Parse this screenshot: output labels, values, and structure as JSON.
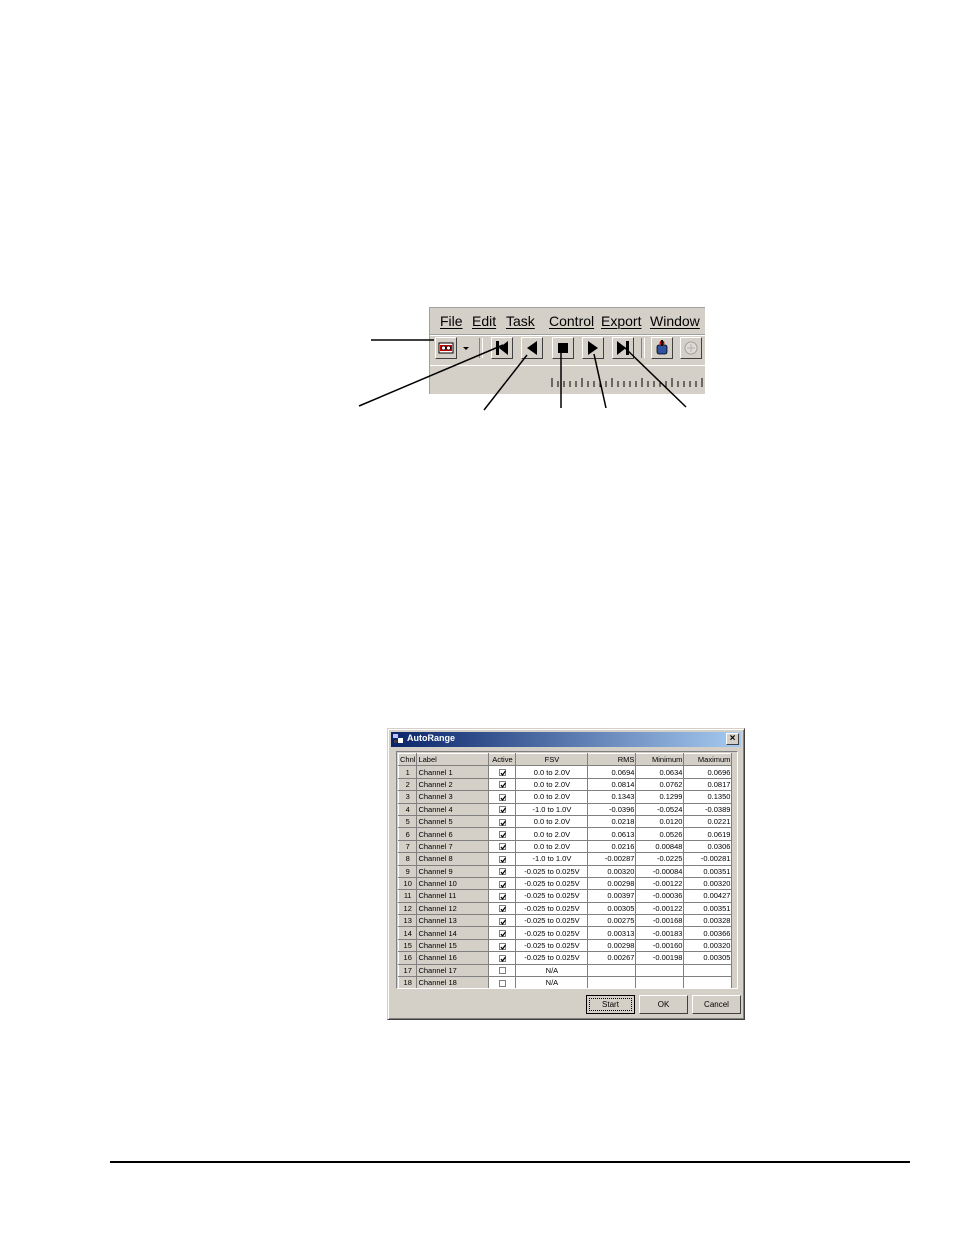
{
  "toolbar_screenshot": {
    "menu": [
      "File",
      "Edit",
      "Task",
      "Control",
      "Export",
      "Window"
    ],
    "buttons": [
      {
        "name": "record-icon"
      },
      {
        "name": "dropdown-arrow-icon"
      },
      {
        "name": "skip-to-start-icon"
      },
      {
        "name": "reverse-play-icon"
      },
      {
        "name": "stop-icon"
      },
      {
        "name": "play-icon"
      },
      {
        "name": "skip-to-end-icon"
      },
      {
        "name": "acquire-icon"
      },
      {
        "name": "disabled-tool-icon"
      }
    ]
  },
  "dialog": {
    "title": "AutoRange",
    "close": "×",
    "columns": [
      "Chnl",
      "Label",
      "Active",
      "FSV",
      "RMS",
      "Minimum",
      "Maximum"
    ],
    "rows": [
      {
        "chnl": "1",
        "label": "Channel 1",
        "active": true,
        "fsv": "0.0 to 2.0V",
        "rms": "0.0694",
        "min": "0.0634",
        "max": "0.0696"
      },
      {
        "chnl": "2",
        "label": "Channel 2",
        "active": true,
        "fsv": "0.0 to 2.0V",
        "rms": "0.0814",
        "min": "0.0762",
        "max": "0.0817"
      },
      {
        "chnl": "3",
        "label": "Channel 3",
        "active": true,
        "fsv": "0.0 to 2.0V",
        "rms": "0.1343",
        "min": "0.1299",
        "max": "0.1350"
      },
      {
        "chnl": "4",
        "label": "Channel 4",
        "active": true,
        "fsv": "-1.0 to 1.0V",
        "rms": "-0.0396",
        "min": "-0.0524",
        "max": "-0.0389"
      },
      {
        "chnl": "5",
        "label": "Channel 5",
        "active": true,
        "fsv": "0.0 to 2.0V",
        "rms": "0.0218",
        "min": "0.0120",
        "max": "0.0221"
      },
      {
        "chnl": "6",
        "label": "Channel 6",
        "active": true,
        "fsv": "0.0 to 2.0V",
        "rms": "0.0613",
        "min": "0.0526",
        "max": "0.0619"
      },
      {
        "chnl": "7",
        "label": "Channel 7",
        "active": true,
        "fsv": "0.0 to 2.0V",
        "rms": "0.0216",
        "min": "0.00848",
        "max": "0.0306"
      },
      {
        "chnl": "8",
        "label": "Channel 8",
        "active": true,
        "fsv": "-1.0 to 1.0V",
        "rms": "-0.00287",
        "min": "-0.0225",
        "max": "-0.00281"
      },
      {
        "chnl": "9",
        "label": "Channel 9",
        "active": true,
        "fsv": "-0.025 to 0.025V",
        "rms": "0.00320",
        "min": "-0.00084",
        "max": "0.00351"
      },
      {
        "chnl": "10",
        "label": "Channel 10",
        "active": true,
        "fsv": "-0.025 to 0.025V",
        "rms": "0.00298",
        "min": "-0.00122",
        "max": "0.00320"
      },
      {
        "chnl": "11",
        "label": "Channel 11",
        "active": true,
        "fsv": "-0.025 to 0.025V",
        "rms": "0.00397",
        "min": "-0.00036",
        "max": "0.00427"
      },
      {
        "chnl": "12",
        "label": "Channel 12",
        "active": true,
        "fsv": "-0.025 to 0.025V",
        "rms": "0.00305",
        "min": "-0.00122",
        "max": "0.00351"
      },
      {
        "chnl": "13",
        "label": "Channel 13",
        "active": true,
        "fsv": "-0.025 to 0.025V",
        "rms": "0.00275",
        "min": "-0.00168",
        "max": "0.00328"
      },
      {
        "chnl": "14",
        "label": "Channel 14",
        "active": true,
        "fsv": "-0.025 to 0.025V",
        "rms": "0.00313",
        "min": "-0.00183",
        "max": "0.00366"
      },
      {
        "chnl": "15",
        "label": "Channel 15",
        "active": true,
        "fsv": "-0.025 to 0.025V",
        "rms": "0.00298",
        "min": "-0.00160",
        "max": "0.00320"
      },
      {
        "chnl": "16",
        "label": "Channel 16",
        "active": true,
        "fsv": "-0.025 to 0.025V",
        "rms": "0.00267",
        "min": "-0.00198",
        "max": "0.00305"
      },
      {
        "chnl": "17",
        "label": "Channel 17",
        "active": false,
        "fsv": "N/A",
        "rms": "",
        "min": "",
        "max": ""
      },
      {
        "chnl": "18",
        "label": "Channel 18",
        "active": false,
        "fsv": "N/A",
        "rms": "",
        "min": "",
        "max": ""
      }
    ],
    "buttons": {
      "start": "Start",
      "ok": "OK",
      "cancel": "Cancel"
    }
  }
}
